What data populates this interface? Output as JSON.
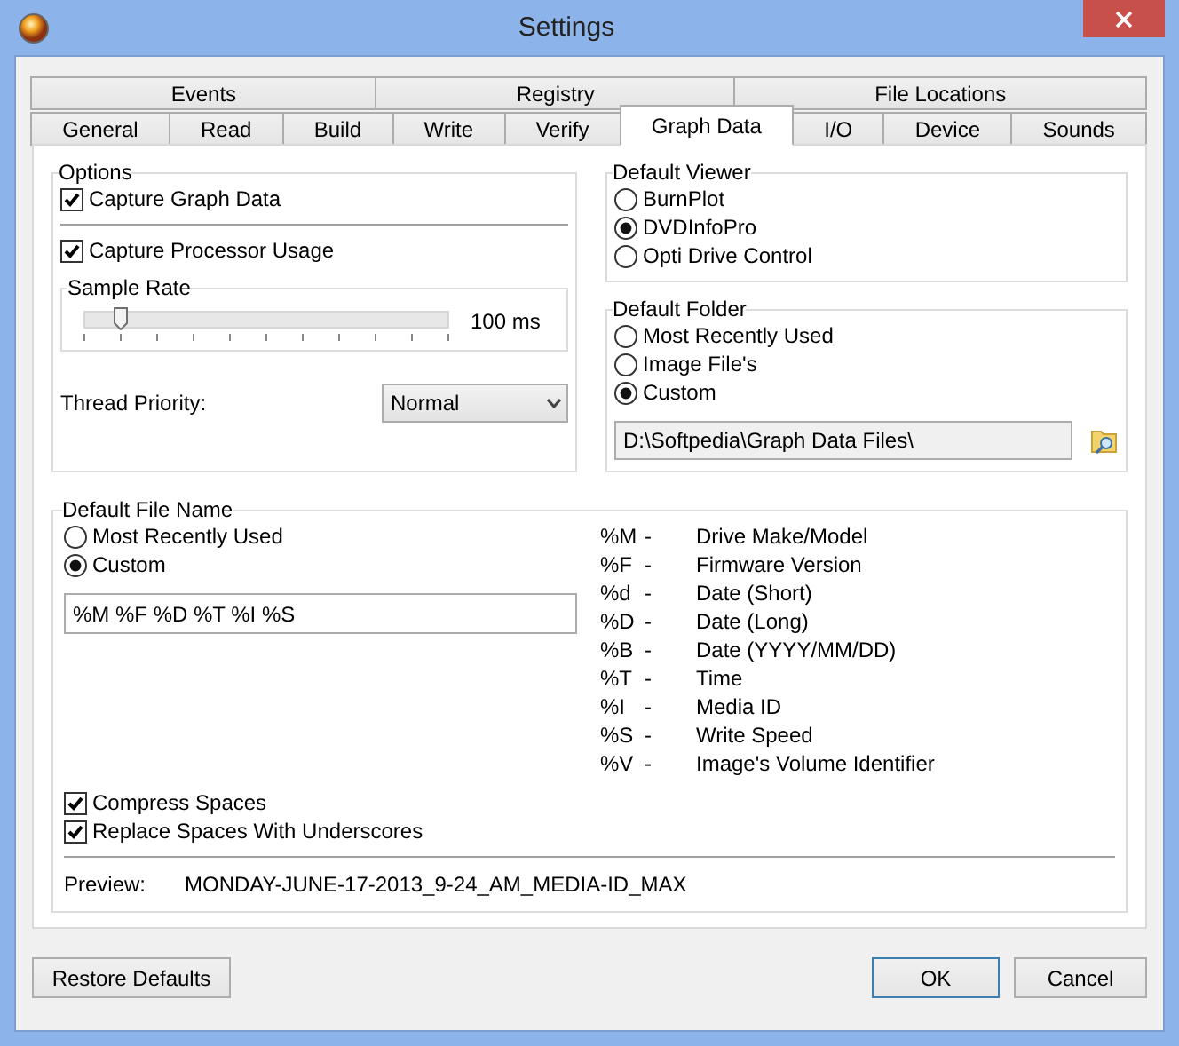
{
  "window": {
    "title": "Settings"
  },
  "tabs_top": [
    {
      "label": "Events",
      "selected": false
    },
    {
      "label": "Registry",
      "selected": false
    },
    {
      "label": "File Locations",
      "selected": false
    }
  ],
  "tabs_bottom": [
    {
      "label": "General",
      "selected": false
    },
    {
      "label": "Read",
      "selected": false
    },
    {
      "label": "Build",
      "selected": false
    },
    {
      "label": "Write",
      "selected": false
    },
    {
      "label": "Verify",
      "selected": false
    },
    {
      "label": "Graph Data",
      "selected": true
    },
    {
      "label": "I/O",
      "selected": false
    },
    {
      "label": "Device",
      "selected": false
    },
    {
      "label": "Sounds",
      "selected": false
    }
  ],
  "options": {
    "title": "Options",
    "capture_graph": {
      "label": "Capture Graph Data",
      "checked": true
    },
    "capture_processor": {
      "label": "Capture Processor Usage",
      "checked": true
    },
    "sample_rate": {
      "title": "Sample Rate",
      "level": 0.1,
      "reading": "100 ms"
    },
    "thread_priority": {
      "label": "Thread Priority:",
      "value": "Normal"
    }
  },
  "default_viewer": {
    "title": "Default Viewer",
    "options": [
      {
        "label": "BurnPlot",
        "selected": false
      },
      {
        "label": "DVDInfoPro",
        "selected": true
      },
      {
        "label": "Opti Drive Control",
        "selected": false
      }
    ]
  },
  "default_folder": {
    "title": "Default Folder",
    "options": [
      {
        "label": "Most Recently Used",
        "selected": false
      },
      {
        "label": "Image File's",
        "selected": false
      },
      {
        "label": "Custom",
        "selected": true
      }
    ],
    "path": "D:\\Softpedia\\Graph Data Files\\"
  },
  "default_file_name": {
    "title": "Default File Name",
    "options": [
      {
        "label": "Most Recently Used",
        "selected": false
      },
      {
        "label": "Custom",
        "selected": true
      }
    ],
    "pattern": "%M %F %D %T %I %S",
    "codes": [
      {
        "code": "%M",
        "dash": "-",
        "meaning": "Drive Make/Model"
      },
      {
        "code": "%F",
        "dash": "-",
        "meaning": "Firmware Version"
      },
      {
        "code": "%d",
        "dash": "-",
        "meaning": "Date (Short)"
      },
      {
        "code": "%D",
        "dash": "-",
        "meaning": "Date (Long)"
      },
      {
        "code": "%B",
        "dash": "-",
        "meaning": "Date (YYYY/MM/DD)"
      },
      {
        "code": "%T",
        "dash": "-",
        "meaning": "Time"
      },
      {
        "code": "%I",
        "dash": "-",
        "meaning": "Media ID"
      },
      {
        "code": "%S",
        "dash": "-",
        "meaning": "Write Speed"
      },
      {
        "code": "%V",
        "dash": "-",
        "meaning": "Image's Volume Identifier"
      }
    ],
    "checkboxes": [
      {
        "label": "Compress Spaces",
        "checked": true
      },
      {
        "label": "Replace Spaces With Underscores",
        "checked": true
      }
    ],
    "preview_label": "Preview:",
    "preview": "MONDAY-JUNE-17-2013_9-24_AM_MEDIA-ID_MAX"
  },
  "buttons": {
    "restore": "Restore Defaults",
    "ok": "OK",
    "cancel": "Cancel"
  }
}
